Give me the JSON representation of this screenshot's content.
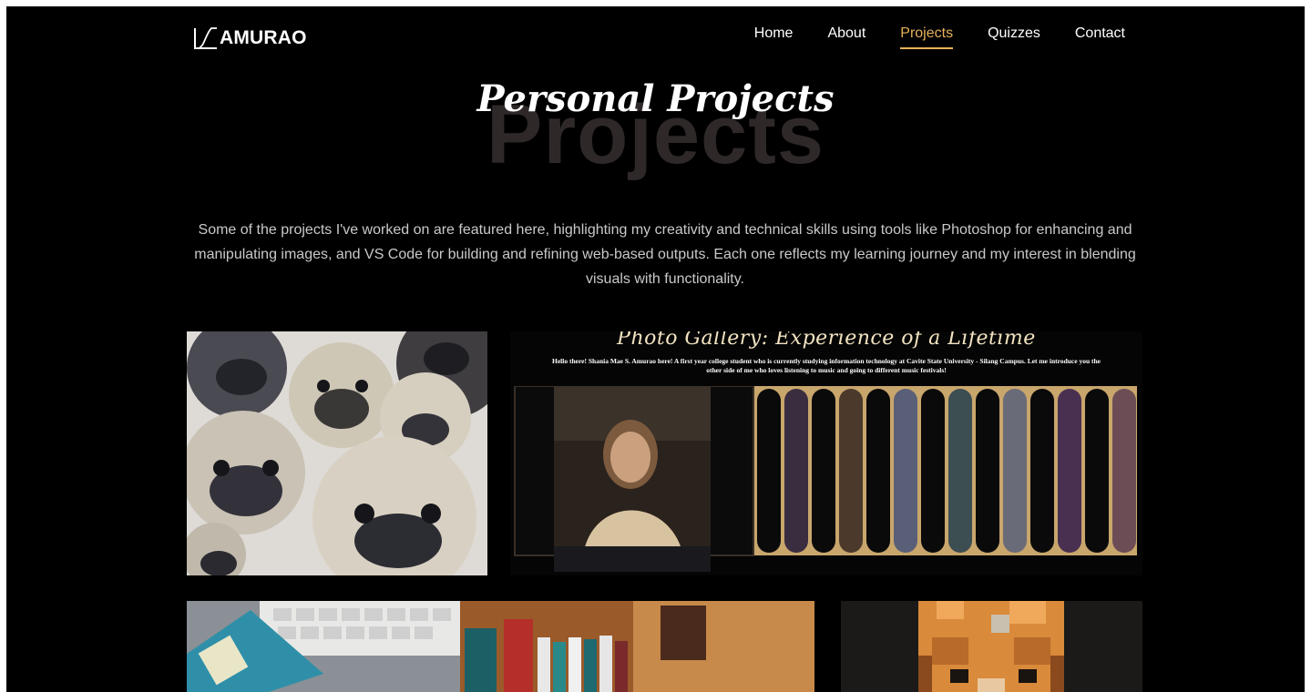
{
  "nav": {
    "logo_text": "AMURAO",
    "links": [
      {
        "label": "Home"
      },
      {
        "label": "About"
      },
      {
        "label": "Projects",
        "active": true
      },
      {
        "label": "Quizzes"
      },
      {
        "label": "Contact"
      }
    ]
  },
  "hero": {
    "background_word": "Projects",
    "title": "Personal Projects",
    "description": "Some of the projects I've worked on are featured here, highlighting my creativity and technical skills using tools like Photoshop for enhancing and manipulating images, and VS Code for building and refining web-based outputs. Each one reflects my learning journey and my interest in blending visuals with functionality."
  },
  "projects": {
    "gallery": {
      "title": "Photo Gallery: Experience of a Lifetime",
      "subtitle": "Hello there! Shania Mae S. Amurao here! A first year college student who is currently studying information technology at Cavite State University - Silang Campus. Let me introduce you the other side of me who loves listening to music and going to different music festivals!"
    }
  },
  "colors": {
    "accent": "#e7b25c",
    "background": "#000000",
    "text": "#ffffff",
    "muted_text": "#c9c9c9",
    "watermark": "#2f2828"
  }
}
